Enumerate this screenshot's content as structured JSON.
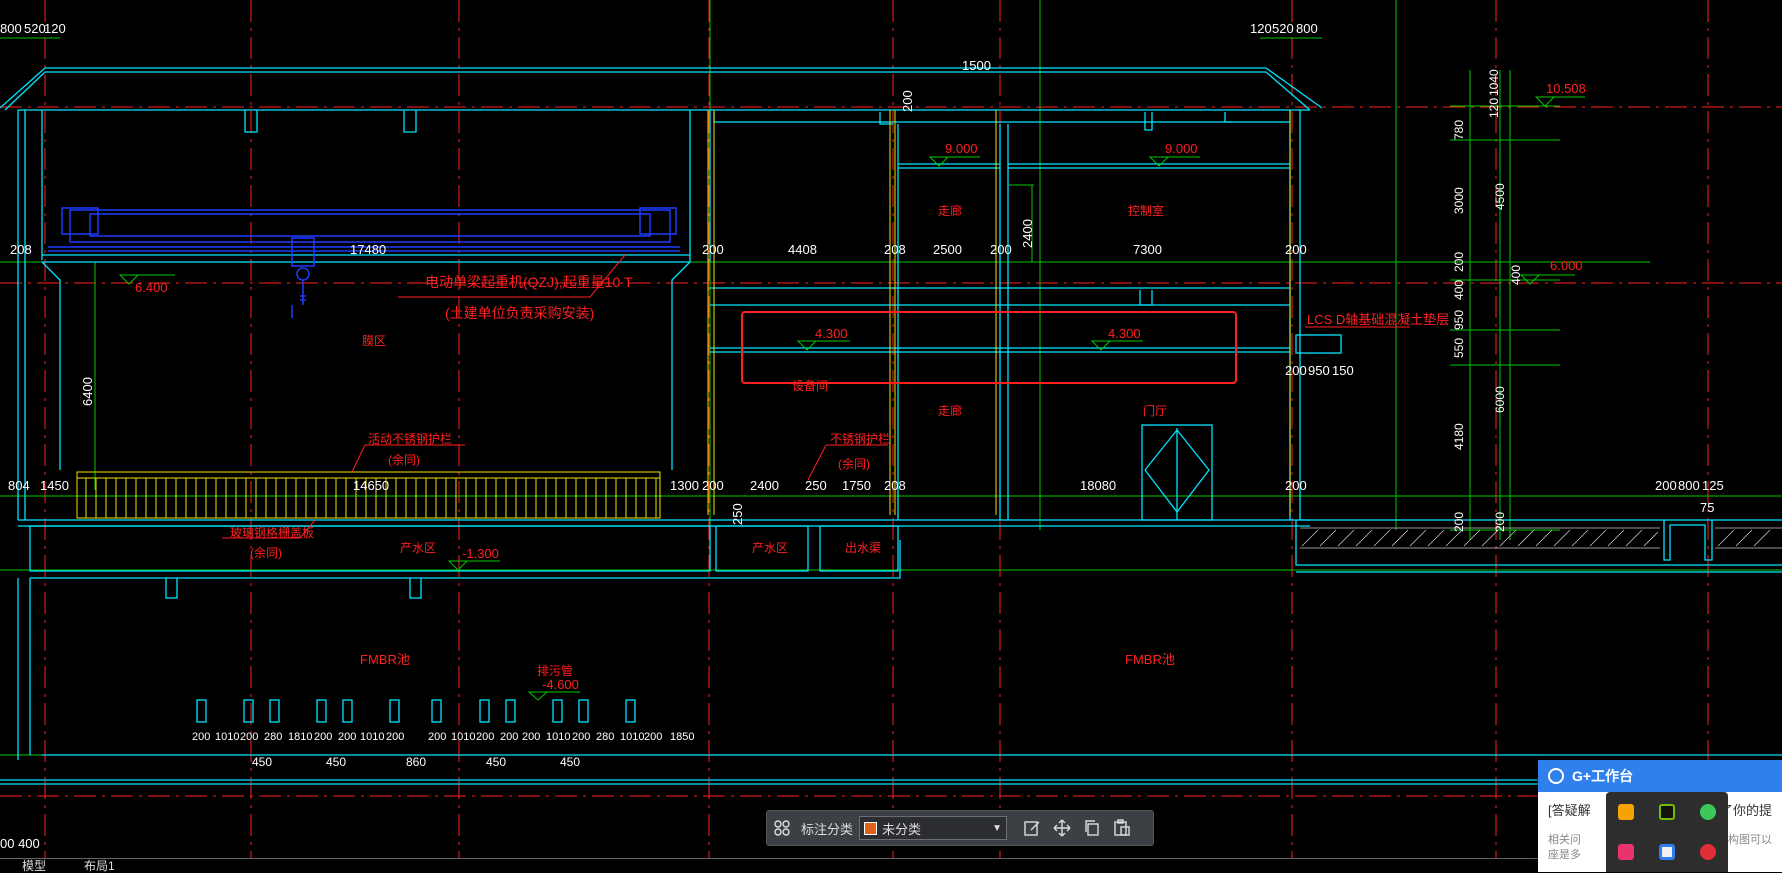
{
  "drawing": {
    "top_dims_left": [
      "800",
      "520",
      "120"
    ],
    "top_dims_right": [
      "120",
      "520",
      "800"
    ],
    "dim_1500": "1500",
    "dim_200_top": "200",
    "elevations": {
      "e9000_a": "9.000",
      "e9000_b": "9.000",
      "e10508": "10.508",
      "e6400": "6.400",
      "e6000": "6.000",
      "e4300_a": "4.300",
      "e4300_b": "4.300",
      "em1300": "-1.300",
      "em4600": "-4.600"
    },
    "spans": {
      "s208_a": "208",
      "s17480": "17480",
      "s200_a": "200",
      "s4408": "4408",
      "s208_b": "208",
      "s2500": "2500",
      "s200_b": "200",
      "s7300": "7300",
      "s200_c": "200",
      "s2400v": "2400",
      "s6400v": "6400"
    },
    "lower_spans": {
      "l804": "804",
      "l1450": "1450",
      "l14650": "14650",
      "l1300": "1300",
      "l200": "200",
      "l2400": "2400",
      "l250": "250",
      "l1750": "1750",
      "l208": "208",
      "l18080": "18080",
      "l200b": "200",
      "l250v": "250",
      "r200": "200",
      "r800": "800",
      "r125": "125",
      "r75": "75"
    },
    "side_spans": {
      "s200_950_150": [
        "200",
        "950",
        "150"
      ]
    },
    "vertical_dims_right_a": [
      "1040",
      "120",
      "780",
      "3000",
      "200",
      "400",
      "950",
      "550",
      "4180",
      "200"
    ],
    "vertical_dims_right_b": [
      "4500",
      "400",
      "6000",
      "200"
    ],
    "bottom_dims_row1": [
      "200",
      "1010",
      "200",
      "280",
      "1810",
      "200",
      "200",
      "1010",
      "200",
      "200",
      "1010",
      "200",
      "200",
      "200",
      "1010",
      "200",
      "280",
      "1010",
      "200",
      "1850"
    ],
    "bottom_dims_row2": [
      "450",
      "450",
      "860",
      "450",
      "450"
    ],
    "bottom_left_dims": "00 400",
    "labels": {
      "crane_note1": "电动单梁起重机(QZJ),起重量10 T",
      "crane_note2": "(土建单位负责采购安装)",
      "workshop": "膜区",
      "guardrail_note1": "活动不锈钢护栏",
      "guardrail_note2": "(余同)",
      "guardrail_note3": "不锈钢护栏",
      "guardrail_note4": "(余同)",
      "floor_note1": "玻璃钢格栅盖板",
      "floor_note2": "(余同)",
      "water_area_a": "产水区",
      "water_area_b": "产水区",
      "outlet": "出水渠",
      "fmbr_a": "FMBR池",
      "fmbr_b": "FMBR池",
      "pipe": "排污管",
      "toilet_a": "走廊",
      "toilet_b": "走廊",
      "control_room": "控制室",
      "equip_room": "设备间",
      "hall": "门厅",
      "lcs": "LCS D轴基础混凝土垫层"
    }
  },
  "toolbar": {
    "label": "标注分类",
    "selected": "未分类",
    "swatch_color": "#e0621b",
    "icons": [
      "grid-icon",
      "edit-icon",
      "move-icon",
      "copy-icon",
      "paste-icon"
    ]
  },
  "tabs": {
    "model": "模型",
    "layout1": "布局1"
  },
  "gpanel": {
    "title": "G+工作台",
    "line1_left": "[答疑解",
    "line1_right": "答了你的提",
    "line2_left": "相关问",
    "line2_right": "结构图可以",
    "line3_left": "座是多"
  },
  "colors": {
    "cyan": "#00e5ff",
    "green": "#00c800",
    "red": "#ff2020",
    "yellow": "#f0e000",
    "blue": "#1e3cff",
    "white": "#ffffff"
  }
}
